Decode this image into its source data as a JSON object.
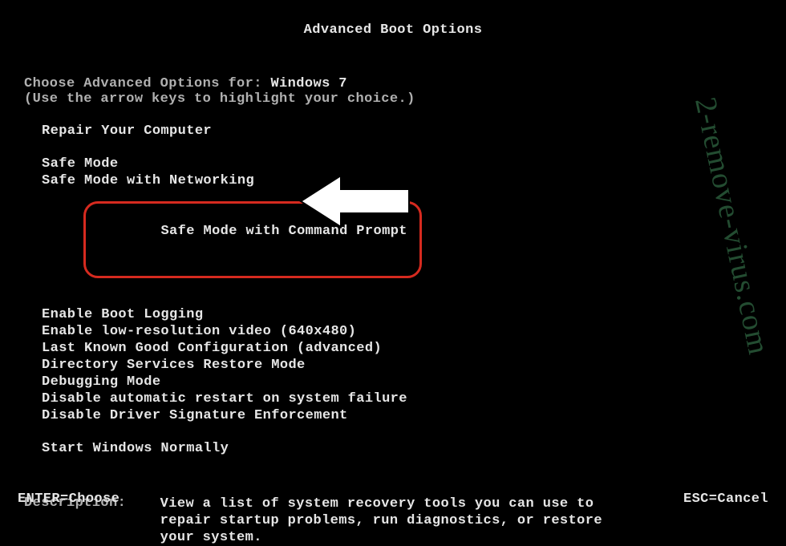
{
  "title": "Advanced Boot Options",
  "choose_prefix": "Choose Advanced Options for: ",
  "os_name": "Windows 7",
  "hint": "(Use the arrow keys to highlight your choice.)",
  "repair": "Repair Your Computer",
  "options": {
    "safe": "Safe Mode",
    "safe_net": "Safe Mode with Networking",
    "safe_cmd": "Safe Mode with Command Prompt",
    "boot_log": "Enable Boot Logging",
    "lowres": "Enable low-resolution video (640x480)",
    "lkgc": "Last Known Good Configuration (advanced)",
    "dsrm": "Directory Services Restore Mode",
    "debug": "Debugging Mode",
    "no_auto_restart": "Disable automatic restart on system failure",
    "no_drv_sig": "Disable Driver Signature Enforcement",
    "normal": "Start Windows Normally"
  },
  "desc_label": "Description:    ",
  "desc_text": "View a list of system recovery tools you can use to repair startup problems, run diagnostics, or restore your system.",
  "footer": {
    "enter": "ENTER=Choose",
    "esc": "ESC=Cancel"
  },
  "watermark": "2-remove-virus.com"
}
